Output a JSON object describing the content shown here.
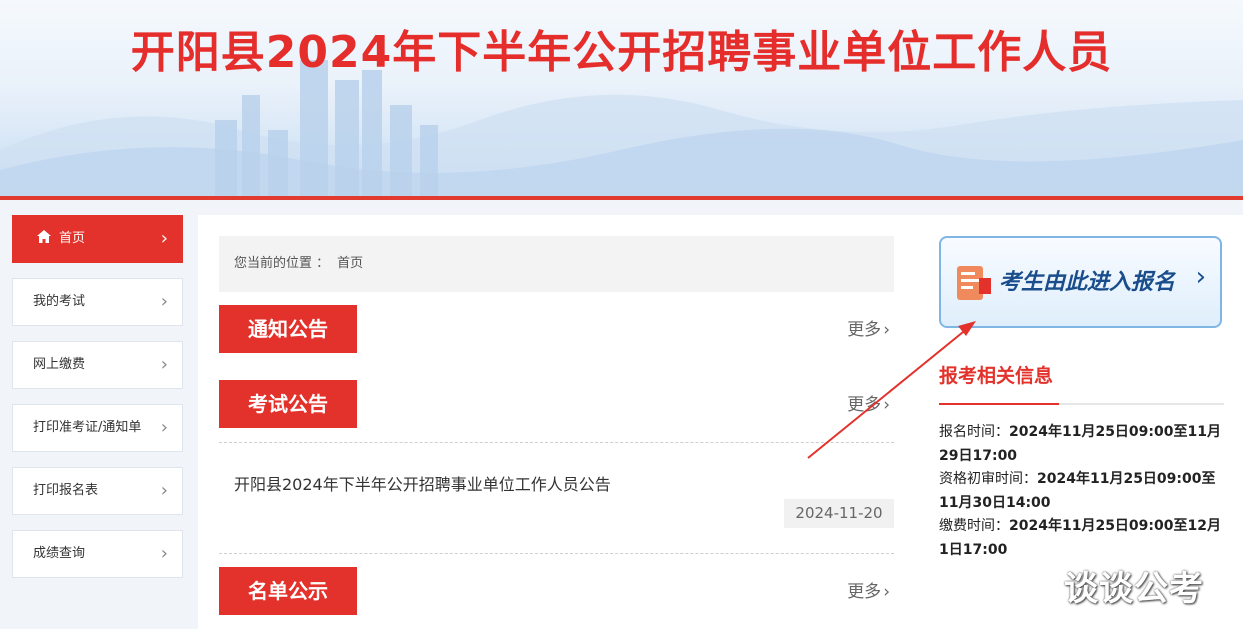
{
  "banner": {
    "title": "开阳县2024年下半年公开招聘事业单位工作人员"
  },
  "sidebar": {
    "items": [
      {
        "label": "首页",
        "icon": "home-icon",
        "active": true
      },
      {
        "label": "我的考试"
      },
      {
        "label": "网上缴费"
      },
      {
        "label": "打印准考证/通知单"
      },
      {
        "label": "打印报名表"
      },
      {
        "label": "成绩查询"
      }
    ],
    "chevron": "›"
  },
  "breadcrumb": {
    "label": "您当前的位置 ：",
    "current": "首页"
  },
  "sections": [
    {
      "title": "通知公告",
      "more": "更多"
    },
    {
      "title": "考试公告",
      "more": "更多"
    },
    {
      "title": "名单公示",
      "more": "更多"
    }
  ],
  "news": [
    {
      "title": "开阳县2024年下半年公开招聘事业单位工作人员公告",
      "date": "2024-11-20"
    }
  ],
  "register": {
    "label": "考生由此进入报名",
    "arrow": "›"
  },
  "info": {
    "title": "报考相关信息",
    "lines": [
      {
        "label": "报名时间：",
        "value": "2024年11月25日09:00至11月29日17:00"
      },
      {
        "label": "资格初审时间：",
        "value": "2024年11月25日09:00至11月30日14:00"
      },
      {
        "label": "缴费时间：",
        "value": "2024年11月25日09:00至12月1日17:00"
      }
    ]
  },
  "watermark": "谈谈公考",
  "colors": {
    "accent": "#e3322b",
    "link_blue": "#1a4d8c",
    "background": "#f1f5fa"
  }
}
